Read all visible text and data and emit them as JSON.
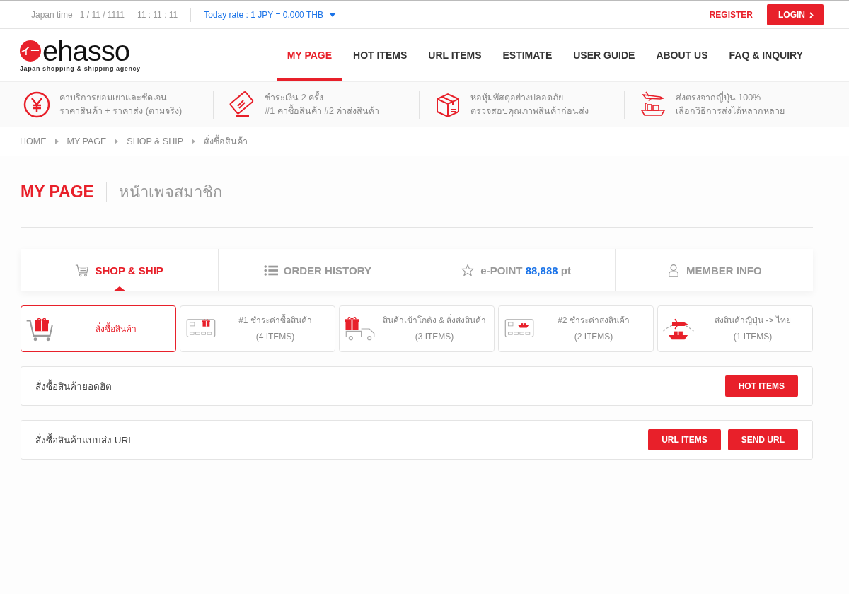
{
  "topbar": {
    "time_label": "Japan time",
    "date": "1 / 11 / 1111",
    "time": "11 : 11 : 11",
    "rate": "Today rate : 1 JPY = 0.000 THB",
    "register": "REGISTER",
    "login": "LOGIN"
  },
  "logo": {
    "mark": "イー",
    "name": "ehasso",
    "tagline": "Japan shopping & shipping agency"
  },
  "nav": [
    {
      "label": "MY PAGE",
      "selected": true
    },
    {
      "label": "HOT ITEMS",
      "selected": false
    },
    {
      "label": "URL ITEMS",
      "selected": false
    },
    {
      "label": "ESTIMATE",
      "selected": false
    },
    {
      "label": "USER GUIDE",
      "selected": false
    },
    {
      "label": "ABOUT US",
      "selected": false
    },
    {
      "label": "FAQ & INQUIRY",
      "selected": false
    }
  ],
  "features": [
    {
      "kind": "yen",
      "lines": [
        "ค่าบริการย่อมเยาและชัดเจน",
        "ราคาสินค้า + ราคาส่ง (ตามจริง)"
      ]
    },
    {
      "kind": "card",
      "lines": [
        "ชำระเงิน 2 ครั้ง",
        "#1 ค่าซื้อสินค้า #2 ค่าส่งสินค้า"
      ]
    },
    {
      "kind": "box",
      "lines": [
        "ห่อหุ้มพัสดุอย่างปลอดภัย",
        "ตรวจสอบคุณภาพสินค้าก่อนส่ง"
      ]
    },
    {
      "kind": "ship",
      "lines": [
        "ส่งตรงจากญี่ปุ่น 100%",
        "เลือกวิธีการส่งได้หลากหลาย"
      ]
    }
  ],
  "breadcrumb": [
    "HOME",
    "MY PAGE",
    "SHOP & SHIP",
    "สั่งซื้อสินค้า"
  ],
  "page_title": {
    "title": "MY PAGE",
    "subtitle": "หน้าเพจสมาชิก"
  },
  "tabs": [
    {
      "kind": "cart",
      "label": "SHOP & SHIP",
      "selected": true
    },
    {
      "kind": "list",
      "label": "ORDER HISTORY",
      "selected": false
    },
    {
      "kind": "star",
      "label": "e-POINT",
      "value": "88,888",
      "unit": "pt",
      "selected": false
    },
    {
      "kind": "person",
      "label": "MEMBER INFO",
      "selected": false
    }
  ],
  "steps": [
    {
      "kind": "cart",
      "title": "สั่งซื้อสินค้า",
      "selected": true
    },
    {
      "kind": "card-cart",
      "title": "#1 ชำระค่าซื้อสินค้า",
      "count": "(4 ITEMS)",
      "selected": false
    },
    {
      "kind": "truck",
      "title": "สินค้าเข้าโกดัง & สั่งส่งสินค้า",
      "count": "(3 ITEMS)",
      "selected": false
    },
    {
      "kind": "card-ship",
      "title": "#2 ชำระค่าส่งสินค้า",
      "count": "(2 ITEMS)",
      "selected": false
    },
    {
      "kind": "ship",
      "title": "ส่งสินค้าญี่ปุ่น -> ไทย",
      "count": "(1 ITEMS)",
      "selected": false
    }
  ],
  "sections": [
    {
      "label": "สั่งซื้อสินค้ายอดฮิต",
      "buttons": [
        "HOT ITEMS"
      ]
    },
    {
      "label": "สั่งซื้อสินค้าแบบส่ง URL",
      "buttons": [
        "URL ITEMS",
        "SEND URL"
      ]
    }
  ]
}
